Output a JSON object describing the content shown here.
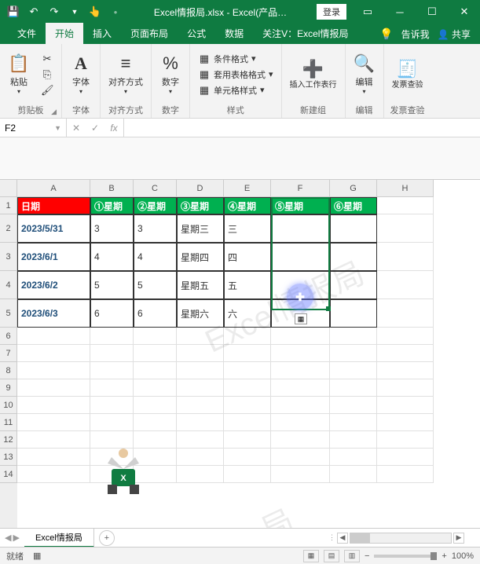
{
  "titlebar": {
    "filename": "Excel情报局.xlsx",
    "separator": " - ",
    "app": "Excel(产品…",
    "login": "登录"
  },
  "tabs": {
    "file": "文件",
    "home": "开始",
    "insert": "插入",
    "layout": "页面布局",
    "formulas": "公式",
    "data": "数据",
    "attention": "关注V：Excel情报局",
    "tell": "告诉我",
    "share": "共享"
  },
  "ribbon": {
    "clipboard": {
      "paste": "粘贴",
      "label": "剪贴板"
    },
    "font": {
      "btn": "字体",
      "label": "字体"
    },
    "align": {
      "btn": "对齐方式",
      "label": "对齐方式"
    },
    "number": {
      "btn": "数字",
      "label": "数字"
    },
    "styles": {
      "cond": "条件格式",
      "table": "套用表格格式",
      "cell": "单元格样式",
      "label": "样式"
    },
    "newgroup": {
      "insert": "插入工作表行",
      "label": "新建组"
    },
    "editing": {
      "btn": "编辑",
      "label": "编辑"
    },
    "invoice": {
      "btn": "发票查验",
      "label": "发票查验"
    }
  },
  "namebox": "F2",
  "cols": [
    "A",
    "B",
    "C",
    "D",
    "E",
    "F",
    "G",
    "H"
  ],
  "rows": [
    "1",
    "2",
    "3",
    "4",
    "5",
    "6",
    "7",
    "8",
    "9",
    "10",
    "11",
    "12",
    "13",
    "14"
  ],
  "data_rows_count": 5,
  "header_row": [
    "日期",
    "①星期",
    "②星期",
    "③星期",
    "④星期",
    "⑤星期",
    "⑥星期"
  ],
  "body_rows": [
    [
      "2023/5/31",
      "3",
      "3",
      "星期三",
      "三",
      "",
      ""
    ],
    [
      "2023/6/1",
      "4",
      "4",
      "星期四",
      "四",
      "",
      ""
    ],
    [
      "2023/6/2",
      "5",
      "5",
      "星期五",
      "五",
      "",
      ""
    ],
    [
      "2023/6/3",
      "6",
      "6",
      "星期六",
      "六",
      "",
      ""
    ]
  ],
  "watermark": "Excel情报局",
  "sheet": "Excel情报局",
  "status": {
    "ready": "就绪",
    "zoom": "100%"
  }
}
